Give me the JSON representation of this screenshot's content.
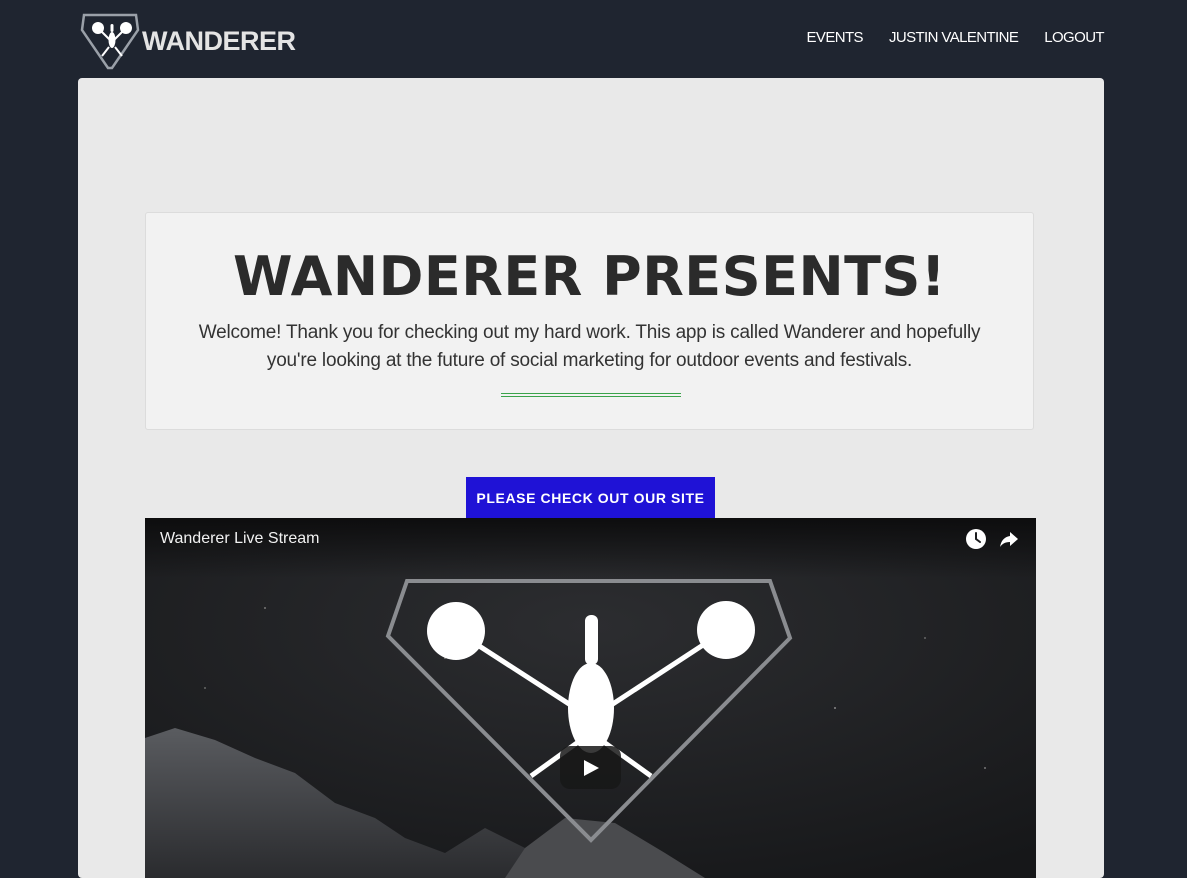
{
  "brand": {
    "name": "WANDERER",
    "logo_icon": "wanderer-diamond-logo"
  },
  "nav": {
    "items": [
      {
        "label": "EVENTS"
      },
      {
        "label": "JUSTIN VALENTINE"
      },
      {
        "label": "LOGOUT"
      }
    ]
  },
  "jumbotron": {
    "heading": "WANDERER PRESENTS!",
    "text": "Welcome! Thank you for checking out my hard work. This app is called Wanderer and hopefully you're looking at the future of social marketing for outdoor events and festivals."
  },
  "cta": {
    "label": "PLEASE CHECK OUT OUR SITE"
  },
  "video": {
    "title": "Wanderer Live Stream",
    "icons": [
      "watch-later-icon",
      "share-icon",
      "play-icon"
    ]
  },
  "colors": {
    "background": "#1f2530",
    "panel": "#e9e9e9",
    "cta": "#1f12d6",
    "divider": "#3aa34a"
  }
}
